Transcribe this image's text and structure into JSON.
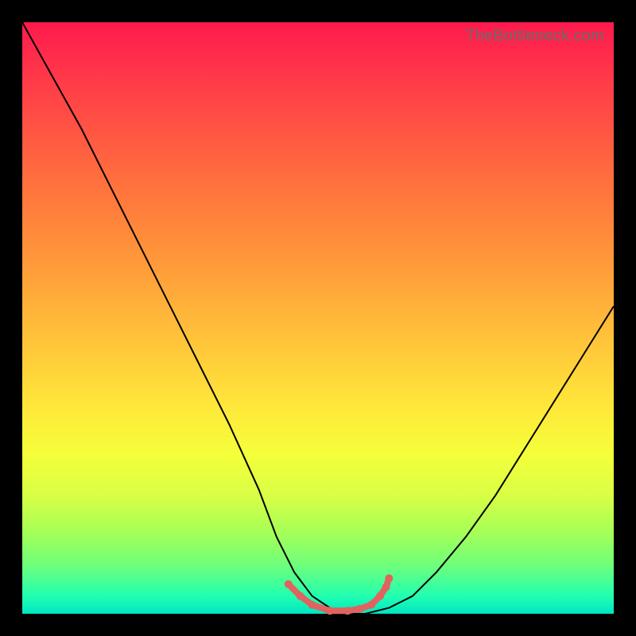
{
  "watermark": "TheBottleneck.com",
  "colors": {
    "frame": "#000000",
    "curve": "#000000",
    "marker": "#e0635f",
    "gradient_top": "#ff1a4d",
    "gradient_bottom": "#00e6c2"
  },
  "chart_data": {
    "type": "line",
    "title": "",
    "xlabel": "",
    "ylabel": "",
    "xlim": [
      0,
      100
    ],
    "ylim": [
      0,
      100
    ],
    "series": [
      {
        "name": "bottleneck-curve",
        "x": [
          0,
          5,
          10,
          15,
          20,
          25,
          30,
          35,
          40,
          43,
          46,
          49,
          52,
          55,
          58,
          62,
          66,
          70,
          75,
          80,
          85,
          90,
          95,
          100
        ],
        "y": [
          100,
          91,
          82,
          72,
          62,
          52,
          42,
          32,
          21,
          13,
          7,
          3,
          1,
          0,
          0,
          1,
          3,
          7,
          13,
          20,
          28,
          36,
          44,
          52
        ]
      }
    ],
    "markers": {
      "name": "highlight-band",
      "x": [
        45,
        47,
        49,
        52,
        55,
        57,
        59,
        60.5,
        61.5,
        62
      ],
      "y": [
        5,
        3,
        1.5,
        0.5,
        0.5,
        0.8,
        1.5,
        3,
        4.5,
        6
      ]
    }
  }
}
